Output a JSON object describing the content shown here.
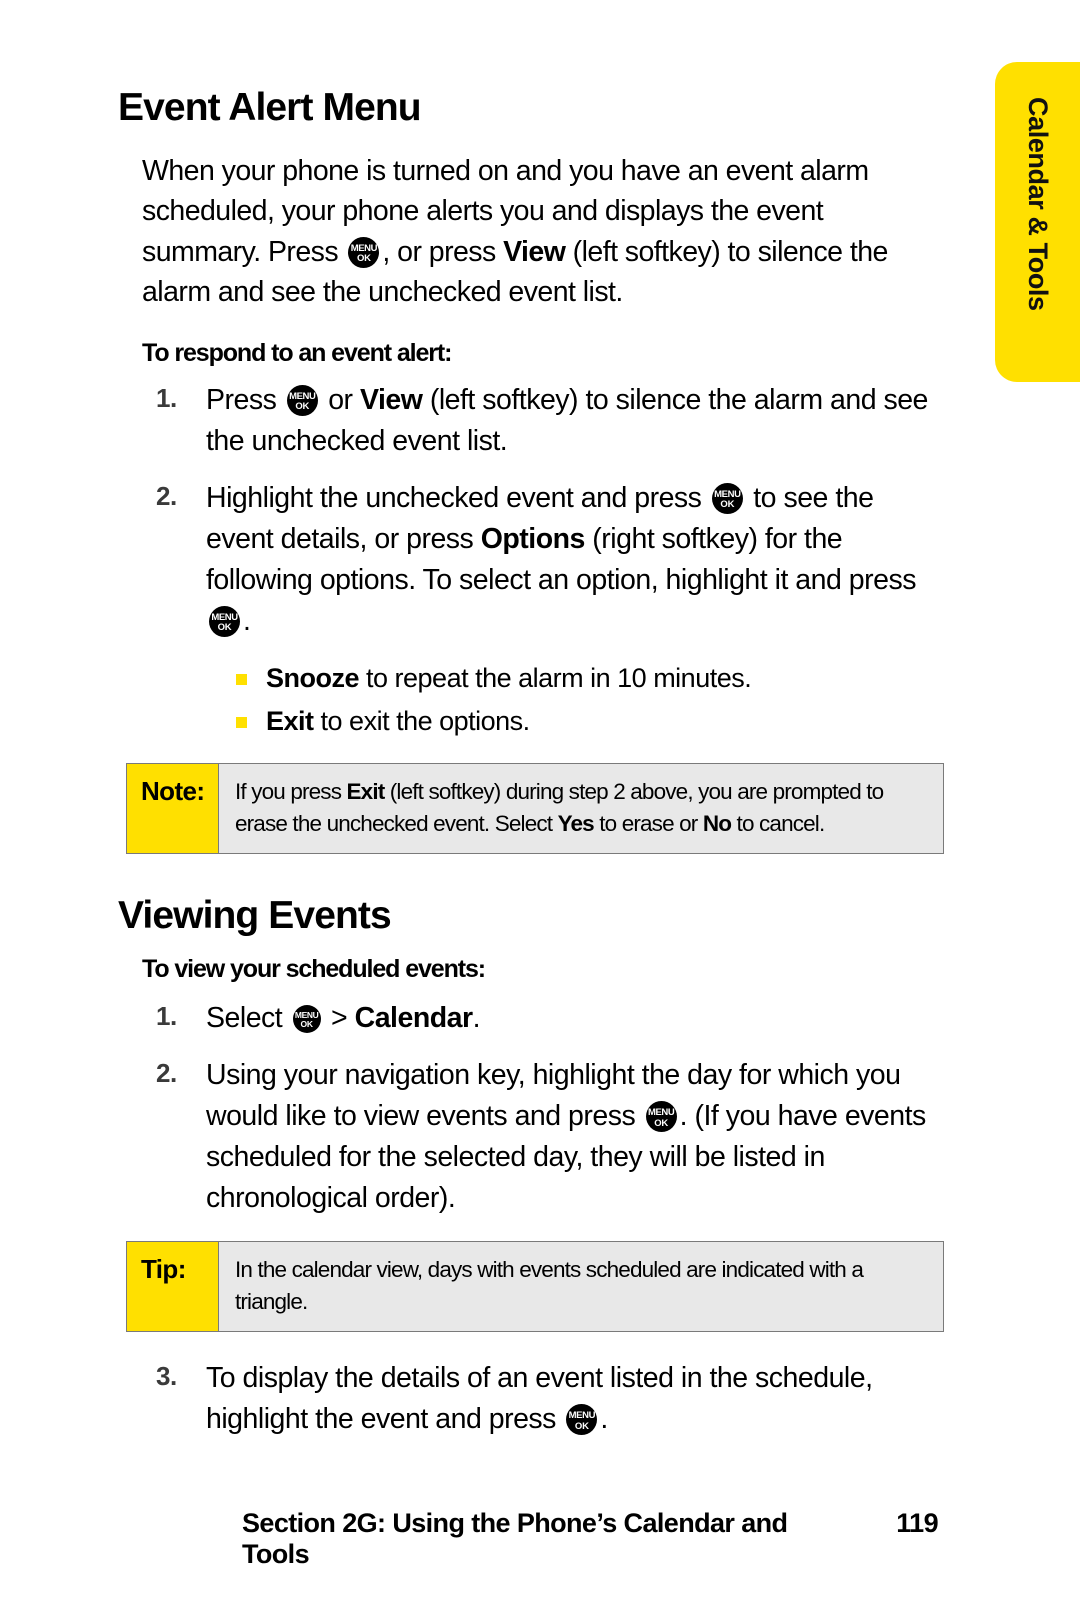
{
  "side_tab": {
    "label": "Calendar & Tools",
    "color": "#FFE000"
  },
  "sections": [
    {
      "title": "Event Alert Menu",
      "intro_parts": {
        "p1": "When your phone is turned on and you have an event alarm scheduled, your phone alerts you and displays the event summary. Press ",
        "p2": ", or press ",
        "bold1": "View",
        "p3": " (left softkey) to silence the alarm and see the unchecked event list."
      },
      "subhead": "To respond to an event alert:",
      "steps": [
        {
          "num": "1.",
          "p1": "Press ",
          "p2": " or ",
          "bold1": "View",
          "p3": " (left softkey) to silence the alarm and see the unchecked event list."
        },
        {
          "num": "2.",
          "p1": "Highlight the unchecked event and press ",
          "p2": " to see the event details, or press ",
          "bold1": "Options",
          "p3": " (right softkey) for the following options. To select an option, highlight it and press ",
          "p4": "."
        }
      ],
      "bullets": [
        {
          "bold": "Snooze",
          "text": " to repeat the alarm in 10 minutes."
        },
        {
          "bold": "Exit",
          "text": " to exit the options."
        }
      ],
      "callout": {
        "label": "Note:",
        "p1": "If you press ",
        "bold1": "Exit",
        "p2": " (left softkey) during step 2 above, you are prompted to erase the unchecked event. Select ",
        "bold2": "Yes",
        "p3": " to erase or ",
        "bold3": "No",
        "p4": " to cancel."
      }
    },
    {
      "title": "Viewing Events",
      "subhead": "To view your scheduled events:",
      "steps": [
        {
          "num": "1.",
          "p1": "Select ",
          "p2": " > ",
          "bold1": "Calendar",
          "p3": "."
        },
        {
          "num": "2.",
          "p1": "Using your navigation key, highlight the day for which you would like to view events and press ",
          "p2": ". (If you have events scheduled for the selected day, they will be listed in chronological order)."
        },
        {
          "num": "3.",
          "p1": "To display the details of an event listed in the schedule, highlight the event and press ",
          "p2": "."
        }
      ],
      "callout": {
        "label": "Tip:",
        "p1": "In the calendar view, days with events scheduled are indicated with a triangle."
      }
    }
  ],
  "menu_key_icon": {
    "line1": "MENU",
    "line2": "OK"
  },
  "footer": {
    "text": "Section 2G: Using the Phone’s Calendar and Tools",
    "page": "119"
  }
}
